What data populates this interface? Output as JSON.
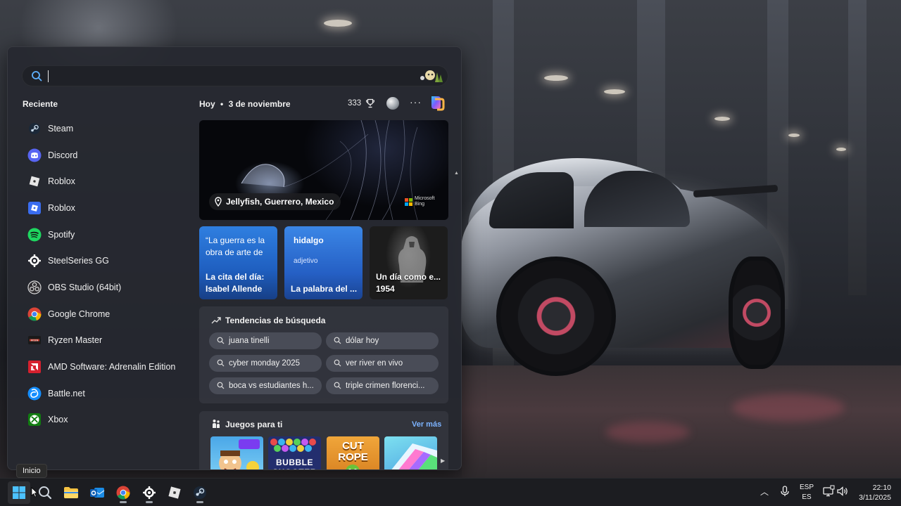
{
  "search": {
    "value": "",
    "placeholder": ""
  },
  "recent": {
    "title": "Reciente",
    "items": [
      {
        "label": "Steam",
        "icon": "steam-icon"
      },
      {
        "label": "Discord",
        "icon": "discord-icon"
      },
      {
        "label": "Roblox",
        "icon": "roblox-icon"
      },
      {
        "label": "Roblox",
        "icon": "roblox-studio-icon"
      },
      {
        "label": "Spotify",
        "icon": "spotify-icon"
      },
      {
        "label": "SteelSeries GG",
        "icon": "steelseries-icon"
      },
      {
        "label": "OBS Studio (64bit)",
        "icon": "obs-icon"
      },
      {
        "label": "Google Chrome",
        "icon": "chrome-icon"
      },
      {
        "label": "Ryzen Master",
        "icon": "ryzen-master-icon"
      },
      {
        "label": "AMD Software: Adrenalin Edition",
        "icon": "amd-icon"
      },
      {
        "label": "Battle.net",
        "icon": "battlenet-icon"
      },
      {
        "label": "Xbox",
        "icon": "xbox-icon"
      }
    ]
  },
  "feed": {
    "day": "Hoy",
    "separator": "•",
    "date": "3 de noviembre",
    "points": "333",
    "more": "···",
    "hero": {
      "caption": "Jellyfish, Guerrero, Mexico",
      "badge_line1": "Microsoft",
      "badge_line2": "Bing"
    },
    "cards": {
      "quote": {
        "top": "“La guerra es la obra de arte de",
        "bottom": "La cita del día: Isabel Allende"
      },
      "word": {
        "top": "hidalgo",
        "sub": "adjetivo",
        "bottom": "La palabra del ..."
      },
      "history": {
        "bottom": "Un día como e... 1954"
      }
    },
    "trends": {
      "title": "Tendencias de búsqueda",
      "items": [
        "juana tinelli",
        "dólar hoy",
        "cyber monday 2025",
        "ver river en vivo",
        "boca vs estudiantes h...",
        "triple crimen florenci..."
      ]
    },
    "games": {
      "title": "Juegos para ti",
      "more": "Ver más",
      "tiles": [
        "crazy-games-tile",
        "BUBBLE SHOOTER",
        "CUT ROPE",
        "color-slide-tile"
      ]
    }
  },
  "tooltip": "Inicio",
  "taskbar": {
    "apps": [
      "windows-start-icon",
      "search-icon",
      "file-explorer-icon",
      "outlook-icon",
      "chrome-icon",
      "steelseries-icon",
      "roblox-icon",
      "steam-icon"
    ],
    "lang_top": "ESP",
    "lang_bottom": "ES",
    "time": "22:10",
    "date": "3/11/2025"
  },
  "colors": {
    "accent": "#2f7fe0",
    "link": "#7cb3ff",
    "menu_bg": "#262830"
  }
}
